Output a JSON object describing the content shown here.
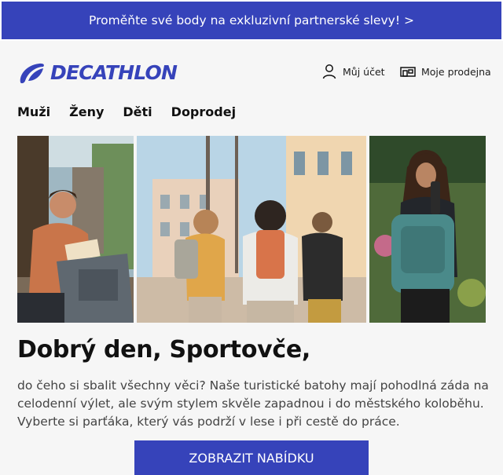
{
  "promo_banner": {
    "text": "Proměňte své body na exkluzivní partnerské slevy! >"
  },
  "header": {
    "logo_text": "DECATHLON",
    "account_label": "Můj účet",
    "store_label": "Moje prodejna"
  },
  "nav": {
    "items": [
      "Muži",
      "Ženy",
      "Děti",
      "Doprodej"
    ]
  },
  "hero": {
    "title": "Dobrý den, Sportovče,",
    "body": "do čeho si sbalit všechny věci? Naše turistické batohy mají pohodlná záda na celodenní výlet, ale svým stylem skvěle zapadnou i do městského koloběhu. Vyberte si parťáka, který vás podrží v lese i při cestě do práce.",
    "cta_label": "ZOBRAZIT NABÍDKU"
  },
  "colors": {
    "brand": "#3643BA",
    "background": "#f6f6f6",
    "text": "#1b1b1b"
  },
  "icons": [
    "decathlon-logo-icon",
    "user-icon",
    "store-icon"
  ]
}
